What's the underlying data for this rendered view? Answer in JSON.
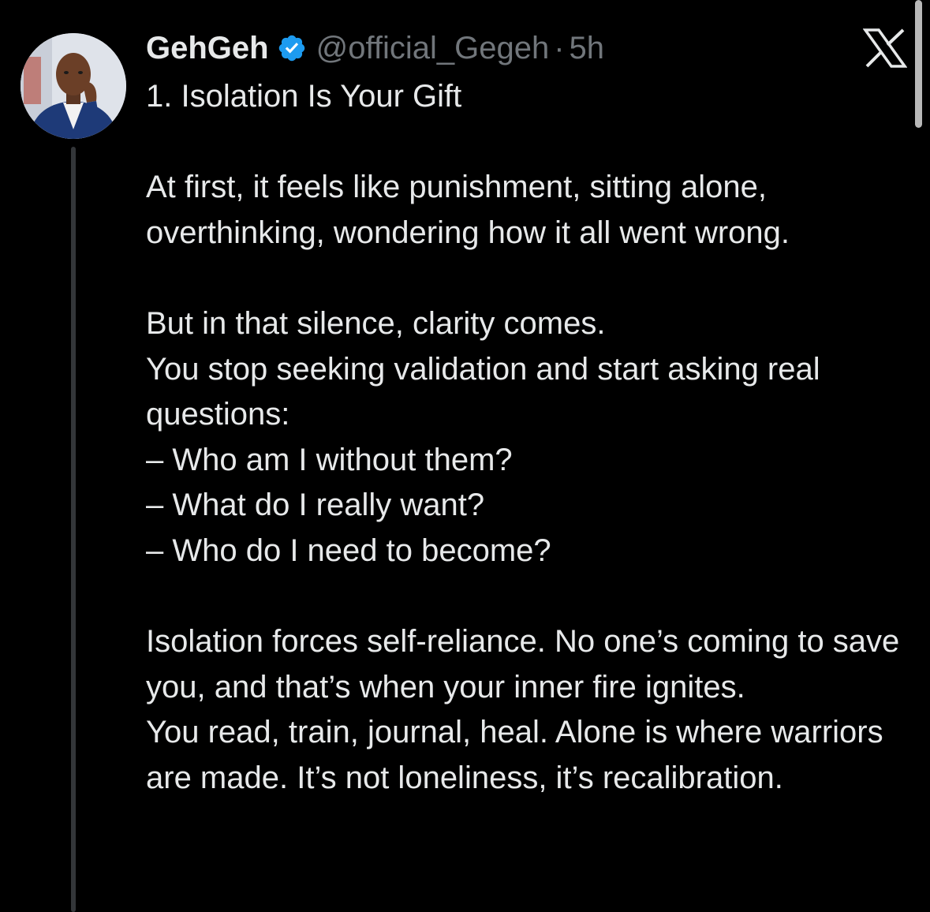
{
  "post": {
    "author": {
      "display_name": "GehGeh",
      "handle": "@official_Gegeh",
      "verified": true,
      "verified_icon": "verified-badge-icon",
      "verified_color": "#1d9bf0",
      "avatar": "avatar-photo"
    },
    "separator": "·",
    "time": "5h",
    "brand_icon": "x-logo-icon",
    "text": "1. Isolation Is Your Gift\n\nAt first, it feels like punishment, sitting alone, overthinking, wondering how it all went wrong.\n\nBut in that silence, clarity comes.\nYou stop seeking validation and start asking real questions:\n– Who am I without them?\n– What do I really want?\n– Who do I need to become?\n\nIsolation forces self-reliance. No one’s coming to save you, and that’s when your inner fire ignites.\nYou read, train, journal, heal. Alone is where warriors are made. It’s not loneliness, it’s recalibration."
  },
  "theme": {
    "background": "#000000",
    "text": "#e7e9ea",
    "muted": "#71767b",
    "thread_line": "#333639"
  }
}
